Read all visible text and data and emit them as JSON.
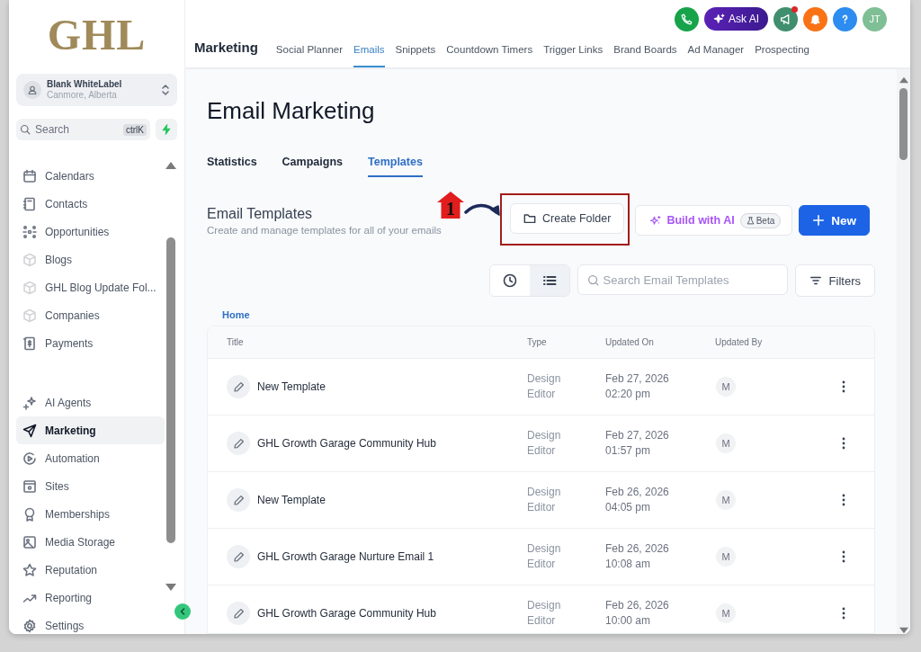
{
  "logo": {
    "text": "GHL"
  },
  "account": {
    "name": "Blank WhiteLabel",
    "location": "Canmore, Alberta"
  },
  "sidebar_search": {
    "placeholder": "Search",
    "shortcut": "ctrlK"
  },
  "sidebar": {
    "groups": [
      {
        "items": [
          {
            "label": "Calendars",
            "kind": "calendar",
            "selected": false
          },
          {
            "label": "Contacts",
            "kind": "contacts",
            "selected": false
          },
          {
            "label": "Opportunities",
            "kind": "opportunities",
            "selected": false
          },
          {
            "label": "Blogs",
            "kind": "cube",
            "selected": false
          },
          {
            "label": "GHL Blog Update Fol...",
            "kind": "cube",
            "selected": false
          },
          {
            "label": "Companies",
            "kind": "cube",
            "selected": false
          },
          {
            "label": "Payments",
            "kind": "payments",
            "selected": false
          }
        ]
      },
      {
        "items": [
          {
            "label": "AI Agents",
            "kind": "sparkle",
            "selected": false
          },
          {
            "label": "Marketing",
            "kind": "send",
            "selected": true
          },
          {
            "label": "Automation",
            "kind": "play",
            "selected": false
          },
          {
            "label": "Sites",
            "kind": "site",
            "selected": false
          },
          {
            "label": "Memberships",
            "kind": "award",
            "selected": false
          },
          {
            "label": "Media Storage",
            "kind": "image",
            "selected": false
          },
          {
            "label": "Reputation",
            "kind": "star",
            "selected": false
          },
          {
            "label": "Reporting",
            "kind": "trend",
            "selected": false
          },
          {
            "label": "Settings",
            "kind": "gear",
            "selected": false
          }
        ]
      }
    ]
  },
  "top_actions": {
    "ask_ai": "Ask AI",
    "avatar": "JT"
  },
  "header": {
    "title": "Marketing",
    "tabs": [
      {
        "label": "Social Planner",
        "selected": false
      },
      {
        "label": "Emails",
        "selected": true
      },
      {
        "label": "Snippets",
        "selected": false
      },
      {
        "label": "Countdown Timers",
        "selected": false
      },
      {
        "label": "Trigger Links",
        "selected": false
      },
      {
        "label": "Brand Boards",
        "selected": false
      },
      {
        "label": "Ad Manager",
        "selected": false
      },
      {
        "label": "Prospecting",
        "selected": false
      }
    ]
  },
  "page": {
    "title": "Email Marketing",
    "tabs": [
      {
        "label": "Statistics",
        "selected": false
      },
      {
        "label": "Campaigns",
        "selected": false
      },
      {
        "label": "Templates",
        "selected": true
      }
    ]
  },
  "section": {
    "title": "Email Templates",
    "subtitle": "Create and manage templates for all of your emails"
  },
  "annotation": {
    "step": "1"
  },
  "actions": {
    "create_folder": "Create Folder",
    "build_with_ai": "Build with AI",
    "beta": "Beta",
    "new": "New"
  },
  "view_toggle": [
    {
      "kind": "recent",
      "selected": false
    },
    {
      "kind": "list",
      "selected": true
    }
  ],
  "template_search": {
    "placeholder": "Search Email Templates"
  },
  "filters": "Filters",
  "breadcrumb": "Home",
  "table": {
    "columns": [
      "Title",
      "Type",
      "Updated On",
      "Updated By"
    ],
    "rows": [
      {
        "title": "New Template",
        "type": "Design Editor",
        "date": "Feb 27, 2026",
        "time": "02:20 pm",
        "avatar": "M"
      },
      {
        "title": "GHL Growth Garage Community Hub",
        "type": "Design Editor",
        "date": "Feb 27, 2026",
        "time": "01:57 pm",
        "avatar": "M"
      },
      {
        "title": "New Template",
        "type": "Design Editor",
        "date": "Feb 26, 2026",
        "time": "04:05 pm",
        "avatar": "M"
      },
      {
        "title": "GHL Growth Garage Nurture Email 1",
        "type": "Design Editor",
        "date": "Feb 26, 2026",
        "time": "10:08 am",
        "avatar": "M"
      },
      {
        "title": "GHL Growth Garage Community Hub",
        "type": "Design Editor",
        "date": "Feb 26, 2026",
        "time": "10:00 am",
        "avatar": "M"
      }
    ]
  }
}
